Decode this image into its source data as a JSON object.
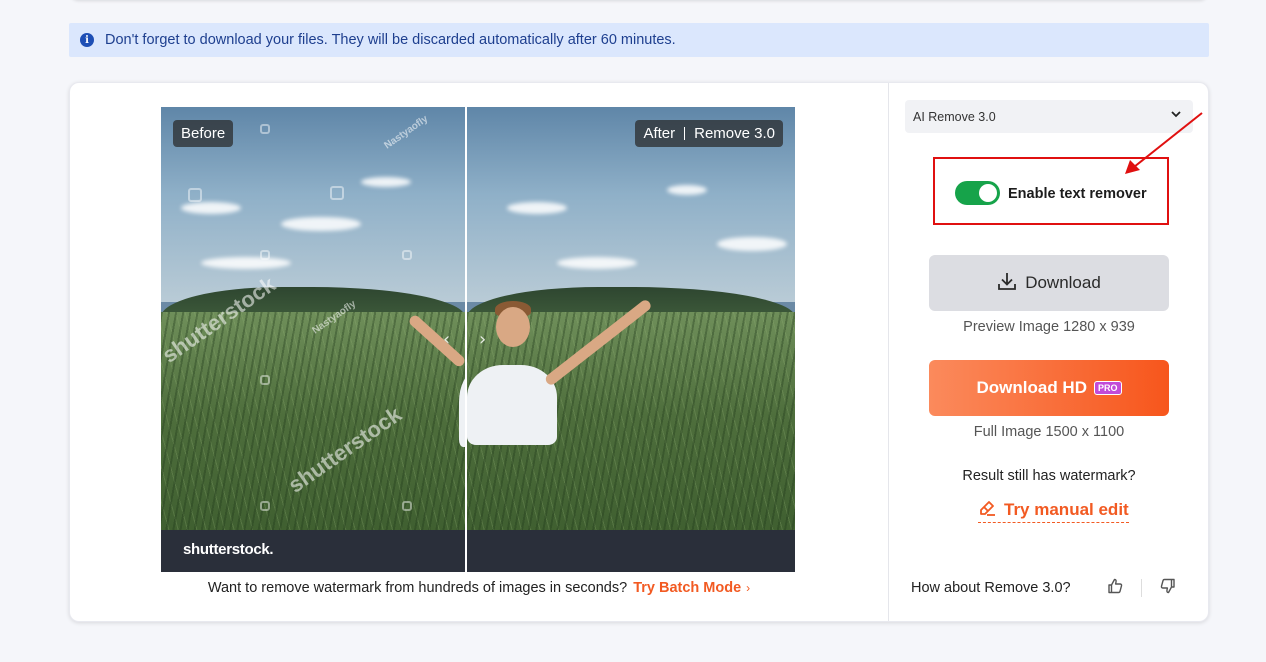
{
  "notice": {
    "text": "Don't forget to download your files. They will be discarded automatically after 60 minutes.",
    "icon": "info-icon"
  },
  "compare": {
    "before_label": "Before",
    "after_label": "After",
    "after_version": "Remove 3.0",
    "watermarks": {
      "small": "Nastyaofly",
      "big": "shutterstock",
      "band_brand": "shutterstock."
    }
  },
  "batch": {
    "text": "Want to remove watermark from hundreds of images in seconds?",
    "link": "Try Batch Mode"
  },
  "panel": {
    "model_select": "AI Remove 3.0",
    "toggle_label": "Enable text remover",
    "toggle_on": true,
    "download_label": "Download",
    "preview_info": "Preview Image 1280 x 939",
    "download_hd_label": "Download HD",
    "pro_badge": "PRO",
    "full_info": "Full Image 1500 x 1100",
    "still_watermark": "Result still has watermark?",
    "manual_edit": "Try manual edit",
    "feedback_question": "How about Remove 3.0?"
  },
  "colors": {
    "accent": "#f25a22",
    "toggle_on": "#16a34a",
    "annotation_red": "#e01010",
    "notice_bg": "#dbe7fd"
  }
}
